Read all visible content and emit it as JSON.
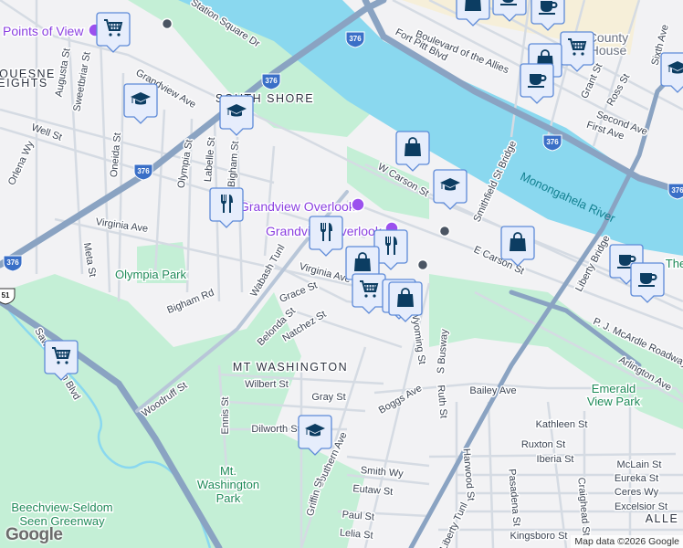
{
  "map": {
    "streets": [
      "Station Square Dr",
      "Grandview Ave",
      "Augusta St",
      "Sweetbriar St",
      "Well St",
      "Orlena Wy",
      "Oneida St",
      "Olympia St",
      "Labelle St",
      "Bigham St",
      "Virginia Ave",
      "Meta St",
      "Virginia Ave",
      "Wabash Tunl",
      "Grace St",
      "Bigham Rd",
      "Belonda St",
      "Natchez St",
      "Saw Mill Run Blvd",
      "Woodruff St",
      "Wilbert St",
      "Gray St",
      "Ennis St",
      "Dilworth St",
      "Southern Ave",
      "Griffin St",
      "Smith Wy",
      "Eutaw St",
      "Paul St",
      "Lelia St",
      "Boggs Ave",
      "Wyoming St",
      "S Busway",
      "Ruth St",
      "Bailey Ave",
      "Kathleen St",
      "Harwood St",
      "Ruxton St",
      "Iberia St",
      "Pasadena St",
      "Craighead St",
      "McLain St",
      "Eureka St",
      "Ceres Wy",
      "Excelsior St",
      "Kingsboro St",
      "Liberty Tunl",
      "Liberty Bridge",
      "P. J. McArdle Roadway",
      "Arlington Ave",
      "E Carson St",
      "W Carson St",
      "Smithfield St Bridge",
      "Fort Pitt Blvd",
      "Boulevard of the Allies",
      "Grant St",
      "Ross St",
      "Second Ave",
      "First Ave",
      "Sixth Ave"
    ],
    "neighborhoods": [
      "QUESNE",
      "EIGHTS",
      "SOUTH SHORE",
      "MT WASHINGTON",
      "ALLE"
    ],
    "parks": [
      "Olympia Park",
      "Mt.",
      "Washington",
      "Park",
      "Beechview-Seldom",
      "Seen Greenway",
      "Emerald",
      "View Park",
      "The"
    ],
    "pois": [
      "Points of View",
      "Grandview Overlook",
      "Grandview Overlook"
    ],
    "landmarks": [
      "County",
      "House"
    ],
    "water": [
      "Monongahela River"
    ],
    "route_shields": [
      "376",
      "376",
      "376",
      "376",
      "376",
      "376",
      "51"
    ],
    "markers": [
      {
        "type": "shopping-cart"
      },
      {
        "type": "graduation-cap"
      },
      {
        "type": "graduation-cap"
      },
      {
        "type": "restaurant"
      },
      {
        "type": "restaurant"
      },
      {
        "type": "shopping-bag"
      },
      {
        "type": "graduation-cap"
      },
      {
        "type": "shopping-bag"
      },
      {
        "type": "coffee"
      },
      {
        "type": "coffee"
      },
      {
        "type": "shopping-bag"
      },
      {
        "type": "restaurant"
      },
      {
        "type": "shopping-bag"
      },
      {
        "type": "shopping-cart"
      },
      {
        "type": "shopping-bag"
      },
      {
        "type": "shopping-cart"
      },
      {
        "type": "shopping-bag"
      },
      {
        "type": "coffee"
      },
      {
        "type": "shopping-cart"
      },
      {
        "type": "graduation-cap"
      },
      {
        "type": "coffee"
      },
      {
        "type": "shopping-bag"
      },
      {
        "type": "coffee"
      },
      {
        "type": "graduation-cap"
      }
    ]
  },
  "footer": {
    "logo": "Google",
    "attribution": "Map data ©2026 Google"
  },
  "colors": {
    "water": "#8ad8ef",
    "park": "#c4efd6",
    "highway": "#8aa3c2",
    "marker_fill": "#e6edfc",
    "marker_border": "#5d8ad8",
    "marker_icon": "#0c3d62",
    "poi": "#8a3fe0"
  }
}
